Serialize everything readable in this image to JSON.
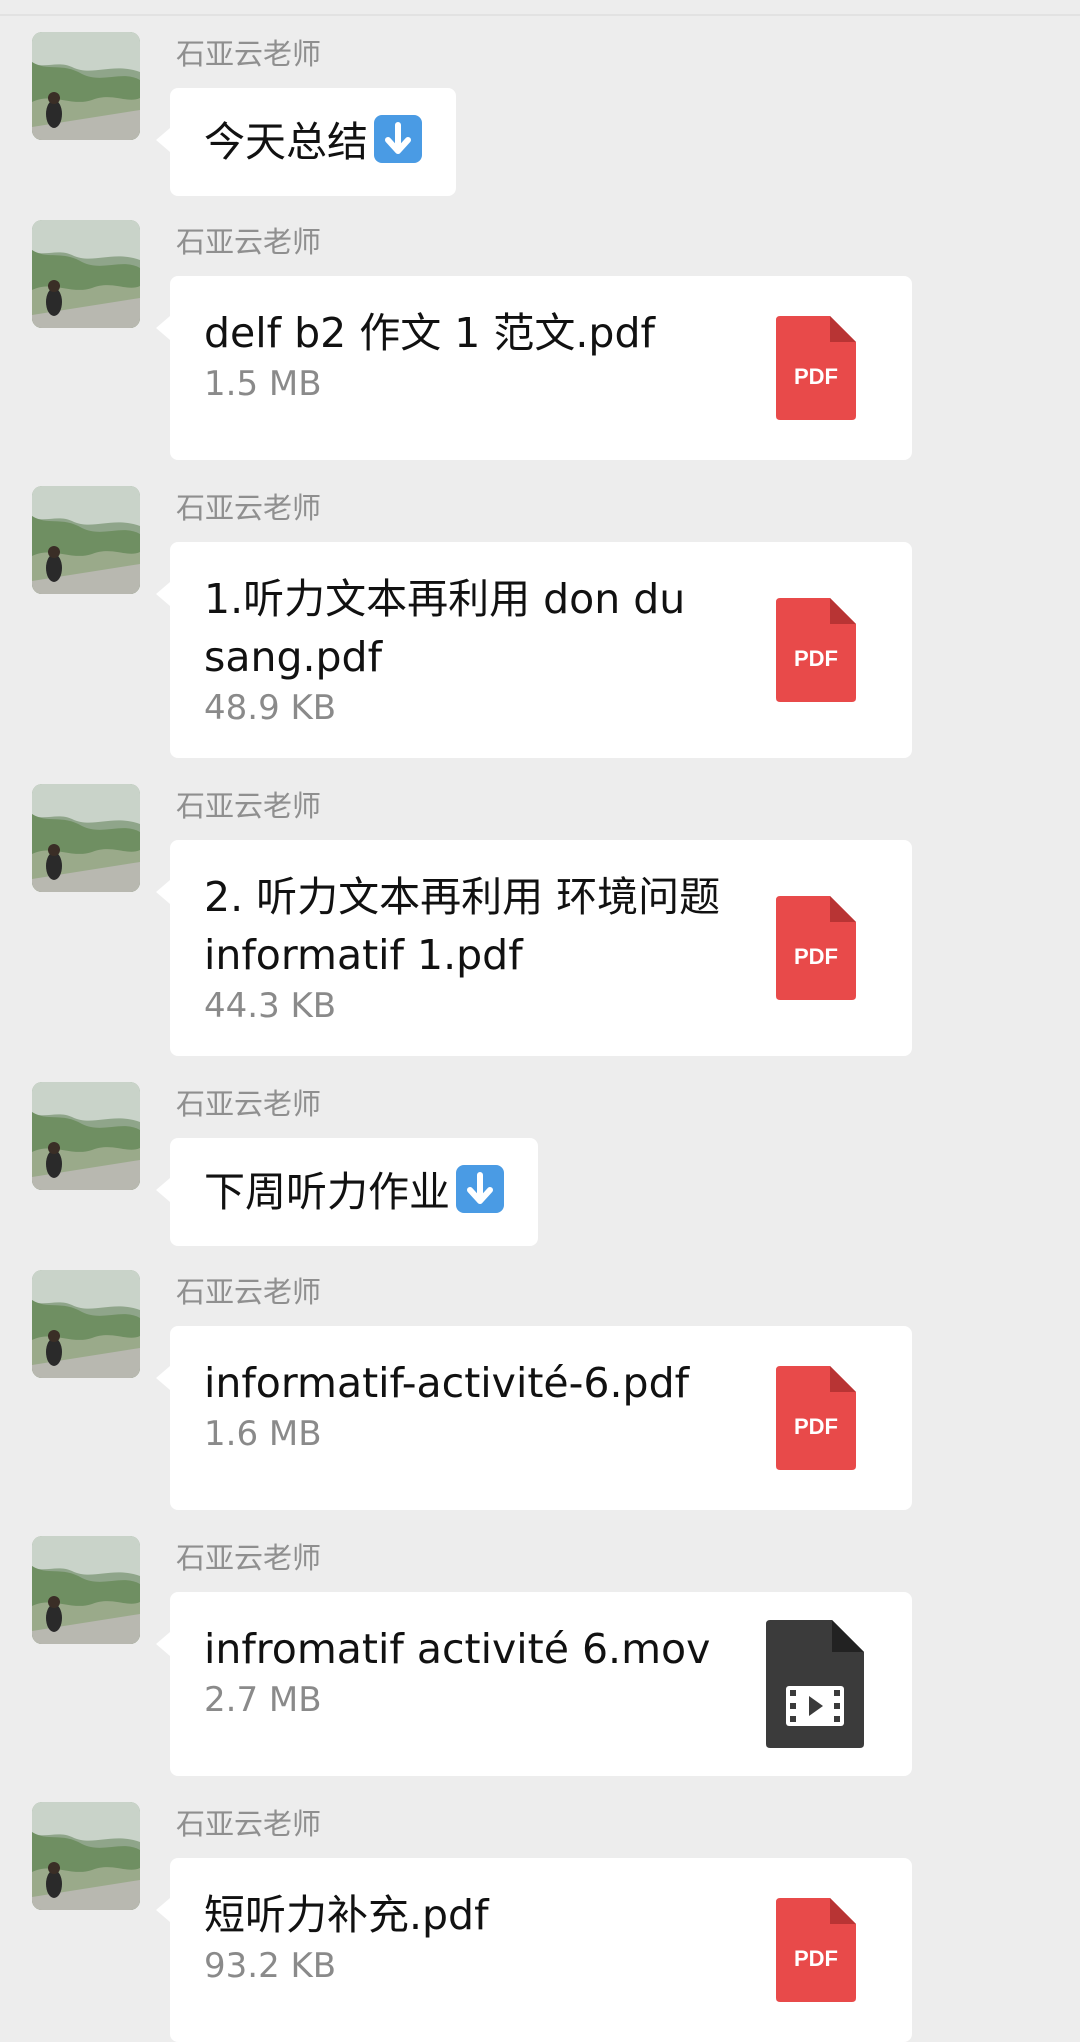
{
  "sender_name": "石亚云老师",
  "messages": [
    {
      "type": "text",
      "text": "今天总结"
    },
    {
      "type": "file",
      "file_name": "delf b2 作文 1 范文.pdf",
      "file_size": "1.5 MB",
      "icon": "pdf-icon",
      "icon_label": "PDF"
    },
    {
      "type": "file",
      "file_name": "1.听力文本再利用 don du sang.pdf",
      "file_size": "48.9 KB",
      "icon": "pdf-icon",
      "icon_label": "PDF"
    },
    {
      "type": "file",
      "file_name": "2. 听力文本再利用 环境问题 informatif 1.pdf",
      "file_size": "44.3 KB",
      "icon": "pdf-icon",
      "icon_label": "PDF"
    },
    {
      "type": "text",
      "text": "下周听力作业"
    },
    {
      "type": "file",
      "file_name": "informatif-activité-6.pdf",
      "file_size": "1.6 MB",
      "icon": "pdf-icon",
      "icon_label": "PDF"
    },
    {
      "type": "file",
      "file_name": "infromatif activité 6.mov",
      "file_size": "2.7 MB",
      "icon": "video-file-icon"
    },
    {
      "type": "file",
      "file_name": "短听力补充.pdf",
      "file_size": "93.2 KB",
      "icon": "pdf-icon",
      "icon_label": "PDF"
    }
  ],
  "colors": {
    "background": "#ededed",
    "bubble": "#ffffff",
    "pdf_icon": "#e84a4a",
    "video_icon": "#3b3b3b",
    "emoji_blue": "#4a9be4"
  }
}
